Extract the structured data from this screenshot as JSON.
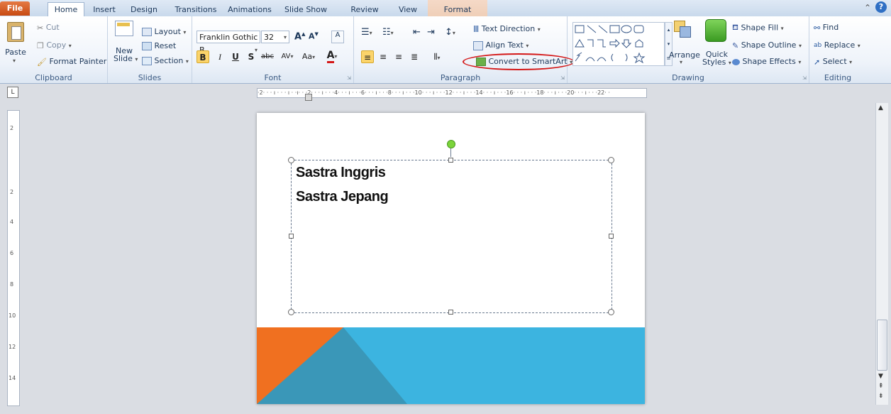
{
  "tabs": [
    {
      "label": "File"
    },
    {
      "label": "Home"
    },
    {
      "label": "Insert"
    },
    {
      "label": "Design"
    },
    {
      "label": "Transitions"
    },
    {
      "label": "Animations"
    },
    {
      "label": "Slide Show"
    },
    {
      "label": "Review"
    },
    {
      "label": "View"
    },
    {
      "label": "Format"
    }
  ],
  "clipboard": {
    "paste": "Paste",
    "cut": "Cut",
    "copy": "Copy",
    "format_painter": "Format Painter",
    "label": "Clipboard"
  },
  "slides": {
    "new_slide_1": "New",
    "new_slide_2": "Slide",
    "layout": "Layout",
    "reset": "Reset",
    "section": "Section",
    "label": "Slides"
  },
  "font": {
    "name": "Franklin Gothic B",
    "size": "32",
    "label": "Font",
    "bold": "B",
    "italic": "I",
    "underline": "U",
    "shadow": "S",
    "strike": "abc",
    "spacing": "AV",
    "case": "Aa",
    "color": "A"
  },
  "paragraph": {
    "text_direction": "Text Direction",
    "align_text": "Align Text",
    "convert_smartart": "Convert to SmartArt",
    "label": "Paragraph"
  },
  "drawing": {
    "arrange": "Arrange",
    "quick_styles_1": "Quick",
    "quick_styles_2": "Styles",
    "shape_fill": "Shape Fill",
    "shape_outline": "Shape Outline",
    "shape_effects": "Shape Effects",
    "label": "Drawing"
  },
  "editing": {
    "find": "Find",
    "replace": "Replace",
    "select": "Select",
    "label": "Editing"
  },
  "ruler": {
    "marks": "·2· · · ı · · · ı · ·ı· · ·2· · · ı · · ·4· · · ı · · ·6· · · ı · · ·8· · · ı · · ·10· · · ı · · ·12· · · ı · · ·14· · · ı · · ·16· · · ı · · ·18· · · ı · · ·20· · · ı · · ·22· ·",
    "vmarks": [
      "2",
      "2",
      "4",
      "6",
      "8",
      "10",
      "12",
      "14"
    ]
  },
  "slide_content": {
    "line1": "Sastra Inggris",
    "line2": "Sastra Jepang"
  },
  "colors": {
    "accent_orange": "#f07020",
    "accent_blue": "#3cb4e0",
    "accent_teal": "#3a97b8",
    "highlight_red": "#d41818"
  }
}
